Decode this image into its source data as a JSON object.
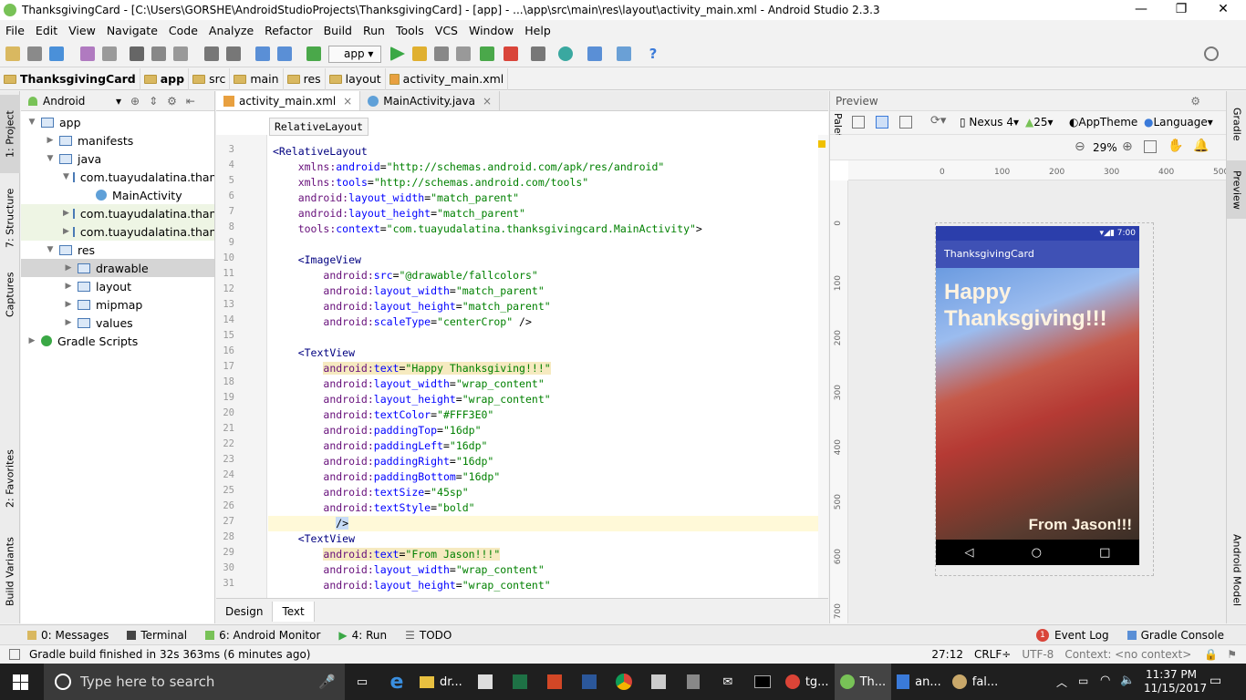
{
  "window": {
    "title": "ThanksgivingCard - [C:\\Users\\GORSHE\\AndroidStudioProjects\\ThanksgivingCard] - [app] - ...\\app\\src\\main\\res\\layout\\activity_main.xml - Android Studio 2.3.3",
    "minimize": "—",
    "restore": "❐",
    "close": "✕"
  },
  "menu": [
    "File",
    "Edit",
    "View",
    "Navigate",
    "Code",
    "Analyze",
    "Refactor",
    "Build",
    "Run",
    "Tools",
    "VCS",
    "Window",
    "Help"
  ],
  "toolbar": {
    "run_config": "app"
  },
  "breadcrumb": [
    "ThanksgivingCard",
    "app",
    "src",
    "main",
    "res",
    "layout",
    "activity_main.xml"
  ],
  "left_tabs": [
    "1: Project",
    "7: Structure",
    "Captures",
    "2: Favorites",
    "Build Variants"
  ],
  "project": {
    "view_mode": "Android",
    "tree": [
      {
        "label": "app",
        "indent": 0,
        "arrow": "▼",
        "kind": "module"
      },
      {
        "label": "manifests",
        "indent": 1,
        "arrow": "▶",
        "kind": "folder"
      },
      {
        "label": "java",
        "indent": 1,
        "arrow": "▼",
        "kind": "folder"
      },
      {
        "label": "com.tuayudalatina.thank",
        "indent": 2,
        "arrow": "▼",
        "kind": "package"
      },
      {
        "label": "MainActivity",
        "indent": 3,
        "arrow": "",
        "kind": "class"
      },
      {
        "label": "com.tuayudalatina.thank",
        "indent": 2,
        "arrow": "▶",
        "kind": "package"
      },
      {
        "label": "com.tuayudalatina.thank",
        "indent": 2,
        "arrow": "▶",
        "kind": "package"
      },
      {
        "label": "res",
        "indent": 1,
        "arrow": "▼",
        "kind": "folder"
      },
      {
        "label": "drawable",
        "indent": 2,
        "arrow": "▶",
        "kind": "folder",
        "selected": true
      },
      {
        "label": "layout",
        "indent": 2,
        "arrow": "▶",
        "kind": "folder"
      },
      {
        "label": "mipmap",
        "indent": 2,
        "arrow": "▶",
        "kind": "folder"
      },
      {
        "label": "values",
        "indent": 2,
        "arrow": "▶",
        "kind": "folder"
      },
      {
        "label": "Gradle Scripts",
        "indent": 0,
        "arrow": "▶",
        "kind": "gradle"
      }
    ]
  },
  "editor": {
    "tabs": [
      {
        "label": "activity_main.xml",
        "active": true
      },
      {
        "label": "MainActivity.java",
        "active": false
      }
    ],
    "tooltip": "RelativeLayout",
    "lines": [
      {
        "n": "3",
        "html": "<span class=\"tg\">&lt;RelativeLayout</span>"
      },
      {
        "n": "4",
        "html": "    <span class=\"ns\">xmlns:</span><span class=\"at\">android</span>=<span class=\"st\">\"http://schemas.android.com/apk/res/android\"</span>"
      },
      {
        "n": "5",
        "html": "    <span class=\"ns\">xmlns:</span><span class=\"at\">tools</span>=<span class=\"st\">\"http://schemas.android.com/tools\"</span>"
      },
      {
        "n": "6",
        "html": "    <span class=\"ns\">android:</span><span class=\"at\">layout_width</span>=<span class=\"st\">\"match_parent\"</span>"
      },
      {
        "n": "7",
        "html": "    <span class=\"ns\">android:</span><span class=\"at\">layout_height</span>=<span class=\"st\">\"match_parent\"</span>"
      },
      {
        "n": "8",
        "html": "    <span class=\"ns\">tools:</span><span class=\"at\">context</span>=<span class=\"st\">\"com.tuayudalatina.thanksgivingcard.MainActivity\"</span>&gt;"
      },
      {
        "n": "9",
        "html": ""
      },
      {
        "n": "10",
        "html": "    <span class=\"tg\">&lt;ImageView</span>"
      },
      {
        "n": "11",
        "html": "        <span class=\"ns\">android:</span><span class=\"at\">src</span>=<span class=\"st\">\"@drawable/fallcolors\"</span>"
      },
      {
        "n": "12",
        "html": "        <span class=\"ns\">android:</span><span class=\"at\">layout_width</span>=<span class=\"st\">\"match_parent\"</span>"
      },
      {
        "n": "13",
        "html": "        <span class=\"ns\">android:</span><span class=\"at\">layout_height</span>=<span class=\"st\">\"match_parent\"</span>"
      },
      {
        "n": "14",
        "html": "        <span class=\"ns\">android:</span><span class=\"at\">scaleType</span>=<span class=\"st\">\"centerCrop\"</span> /&gt;"
      },
      {
        "n": "15",
        "html": ""
      },
      {
        "n": "16",
        "html": "    <span class=\"tg\">&lt;TextView</span>"
      },
      {
        "n": "17",
        "html": "        <span class=\"hl\"><span class=\"ns\">android:</span><span class=\"at\">text</span>=<span class=\"st\">\"Happy Thanksgiving!!!\"</span></span>"
      },
      {
        "n": "18",
        "html": "        <span class=\"ns\">android:</span><span class=\"at\">layout_width</span>=<span class=\"st\">\"wrap_content\"</span>"
      },
      {
        "n": "19",
        "html": "        <span class=\"ns\">android:</span><span class=\"at\">layout_height</span>=<span class=\"st\">\"wrap_content\"</span>"
      },
      {
        "n": "20",
        "html": "        <span class=\"ns\">android:</span><span class=\"at\">textColor</span>=<span class=\"st\">\"#FFF3E0\"</span>"
      },
      {
        "n": "21",
        "html": "        <span class=\"ns\">android:</span><span class=\"at\">paddingTop</span>=<span class=\"st\">\"16dp\"</span>"
      },
      {
        "n": "22",
        "html": "        <span class=\"ns\">android:</span><span class=\"at\">paddingLeft</span>=<span class=\"st\">\"16dp\"</span>"
      },
      {
        "n": "23",
        "html": "        <span class=\"ns\">android:</span><span class=\"at\">paddingRight</span>=<span class=\"st\">\"16dp\"</span>"
      },
      {
        "n": "24",
        "html": "        <span class=\"ns\">android:</span><span class=\"at\">paddingBottom</span>=<span class=\"st\">\"16dp\"</span>"
      },
      {
        "n": "25",
        "html": "        <span class=\"ns\">android:</span><span class=\"at\">textSize</span>=<span class=\"st\">\"45sp\"</span>"
      },
      {
        "n": "26",
        "html": "        <span class=\"ns\">android:</span><span class=\"at\">textStyle</span>=<span class=\"st\">\"bold\"</span>"
      },
      {
        "n": "27",
        "html": "          <span style=\"background:#c7dcf7\">/&gt;</span>"
      },
      {
        "n": "28",
        "html": "    <span class=\"tg\">&lt;TextView</span>"
      },
      {
        "n": "29",
        "html": "        <span class=\"hl\"><span class=\"ns\">android:</span><span class=\"at\">text</span>=<span class=\"st\">\"From Jason!!!\"</span></span>"
      },
      {
        "n": "30",
        "html": "        <span class=\"ns\">android:</span><span class=\"at\">layout_width</span>=<span class=\"st\">\"wrap_content\"</span>"
      },
      {
        "n": "31",
        "html": "        <span class=\"ns\">android:</span><span class=\"at\">layout_height</span>=<span class=\"st\">\"wrap_content\"</span>"
      }
    ],
    "bottom_tabs": [
      "Design",
      "Text"
    ]
  },
  "preview": {
    "title": "Preview",
    "palette": "Palette",
    "device": "Nexus 4",
    "api": "25",
    "theme": "AppTheme",
    "language": "Language",
    "zoom": "29%",
    "ruler_x": [
      "0",
      "100",
      "200",
      "300",
      "400",
      "500"
    ],
    "ruler_y": [
      "0",
      "100",
      "200",
      "300",
      "400",
      "500",
      "600",
      "700"
    ],
    "phone": {
      "time": "7:00",
      "app_title": "ThanksgivingCard",
      "headline": "Happy Thanksgiving!!!",
      "footer": "From Jason!!!"
    }
  },
  "right_tabs": [
    "Gradle",
    "Preview",
    "Android Model"
  ],
  "toolwindows": [
    "0: Messages",
    "Terminal",
    "6: Android Monitor",
    "4: Run",
    "TODO"
  ],
  "toolwindows_right": [
    "Event Log",
    "Gradle Console"
  ],
  "event_count": "1",
  "status": {
    "message": "Gradle build finished in 32s 363ms (6 minutes ago)",
    "position": "27:12",
    "line_sep": "CRLF÷",
    "encoding": "UTF-8",
    "context": "Context: <no context>"
  },
  "taskbar": {
    "search_placeholder": "Type here to search",
    "apps": [
      "dr...",
      "tg...",
      "Th...",
      "an...",
      "fal..."
    ],
    "time": "11:37 PM",
    "date": "11/15/2017"
  }
}
